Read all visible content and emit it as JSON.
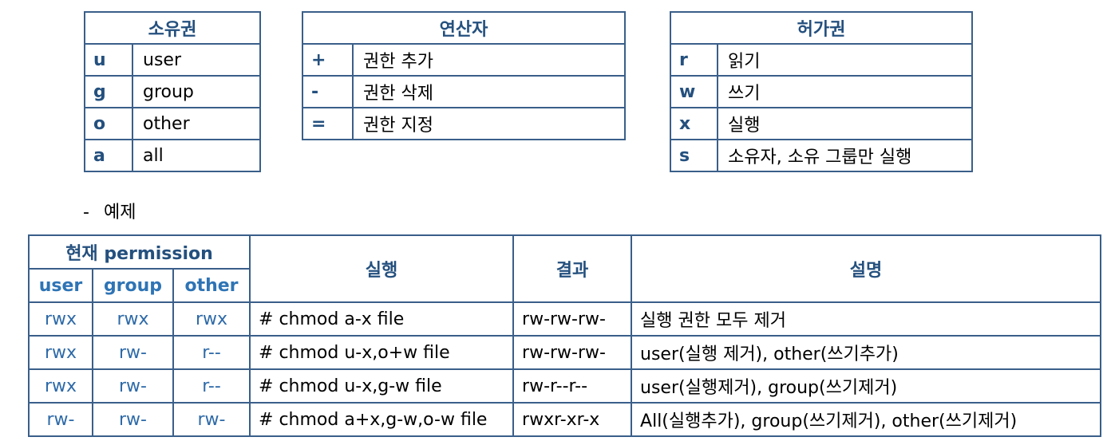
{
  "owner_table": {
    "title": "소유권",
    "rows": [
      {
        "key": "u",
        "value": "user"
      },
      {
        "key": "g",
        "value": "group"
      },
      {
        "key": "o",
        "value": "other"
      },
      {
        "key": "a",
        "value": "all"
      }
    ]
  },
  "operator_table": {
    "title": "연산자",
    "rows": [
      {
        "key": "+",
        "value": "권한 추가"
      },
      {
        "key": "-",
        "value": "권한 삭제"
      },
      {
        "key": "=",
        "value": "권한 지정"
      }
    ]
  },
  "permission_table": {
    "title": "허가권",
    "rows": [
      {
        "key": "r",
        "value": "읽기"
      },
      {
        "key": "w",
        "value": "쓰기"
      },
      {
        "key": "x",
        "value": "실행"
      },
      {
        "key": "s",
        "value": "소유자, 소유 그룹만 실행"
      }
    ]
  },
  "example_label": {
    "dash": "-",
    "text": "예제"
  },
  "examples_table": {
    "headers": {
      "current_permission": "현재 permission",
      "user": "user",
      "group": "group",
      "other": "other",
      "execute": "실행",
      "result": "결과",
      "description": "설명"
    },
    "rows": [
      {
        "user": "rwx",
        "group": "rwx",
        "other": "rwx",
        "command": "# chmod a-x file",
        "result": "rw-rw-rw-",
        "description": "실행 권한 모두 제거"
      },
      {
        "user": "rwx",
        "group": "rw-",
        "other": "r--",
        "command": "# chmod u-x,o+w file",
        "result": "rw-rw-rw-",
        "description": "user(실행 제거), other(쓰기추가)"
      },
      {
        "user": "rwx",
        "group": "rw-",
        "other": "r--",
        "command": "# chmod u-x,g-w file",
        "result": "rw-r--r--",
        "description": "user(실행제거), group(쓰기제거)"
      },
      {
        "user": "rw-",
        "group": "rw-",
        "other": "rw-",
        "command": "# chmod a+x,g-w,o-w file",
        "result": "rwxr-xr-x",
        "description": "All(실행추가), group(쓰기제거), other(쓰기제거)"
      }
    ]
  }
}
